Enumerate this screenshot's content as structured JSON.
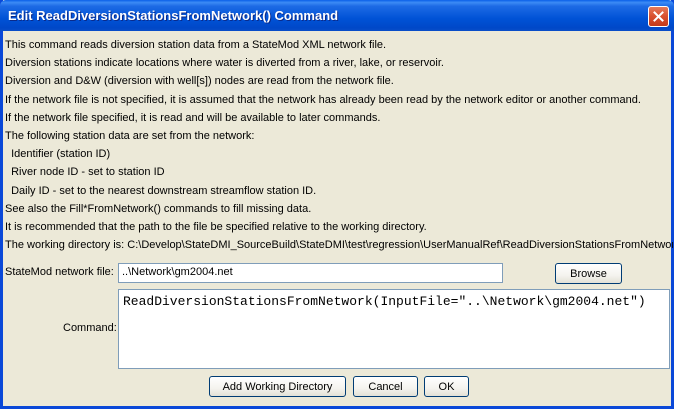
{
  "window": {
    "title": "Edit ReadDiversionStationsFromNetwork() Command"
  },
  "description": {
    "lines": [
      "This command reads diversion station data from a StateMod XML network file.",
      "Diversion stations indicate locations where water is diverted from a river, lake, or reservoir.",
      "Diversion and D&W (diversion with well[s]) nodes are read from the network file.",
      "If the network file is not specified, it is assumed that the network has already been read by the network editor or another command.",
      "If the network file specified, it is read and will be available to later commands.",
      "The following station data are set from the network:",
      "  Identifier (station ID)",
      "  River node ID - set to station ID",
      "  Daily ID - set to the nearest downstream streamflow station ID.",
      "See also the Fill*FromNetwork() commands to fill missing data.",
      "It is recommended that the path to the file be specified relative to the working directory.",
      "The working directory is: C:\\Develop\\StateDMI_SourceBuild\\StateDMI\\test\\regression\\UserManualRef\\ReadDiversionStationsFromNetwork"
    ]
  },
  "form": {
    "network_file_label": "StateMod network file:",
    "network_file_value": "..\\Network\\gm2004.net",
    "browse_label": "Browse",
    "command_label": "Command:",
    "command_value": "ReadDiversionStationsFromNetwork(InputFile=\"..\\Network\\gm2004.net\")"
  },
  "buttons": {
    "add_working_directory": "Add Working Directory",
    "cancel": "Cancel",
    "ok": "OK"
  }
}
